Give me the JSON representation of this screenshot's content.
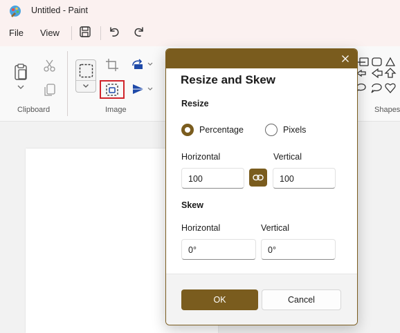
{
  "window": {
    "title": "Untitled - Paint"
  },
  "menu": {
    "file": "File",
    "view": "View"
  },
  "ribbon": {
    "clipboard_label": "Clipboard",
    "image_label": "Image",
    "shapes_label": "Shapes"
  },
  "dialog": {
    "title": "Resize and Skew",
    "resize": {
      "heading": "Resize",
      "option_percentage": "Percentage",
      "option_pixels": "Pixels",
      "selected": "Percentage",
      "horizontal_label": "Horizontal",
      "vertical_label": "Vertical",
      "horizontal_value": "100",
      "vertical_value": "100",
      "maintain_aspect_ratio": true
    },
    "skew": {
      "heading": "Skew",
      "horizontal_label": "Horizontal",
      "vertical_label": "Vertical",
      "horizontal_value": "0°",
      "vertical_value": "0°"
    },
    "ok_label": "OK",
    "cancel_label": "Cancel"
  },
  "colors": {
    "accent": "#7a5c1e",
    "highlight_box": "#d0242b",
    "titlebar_bg": "#fbf1f0"
  },
  "icons": {
    "app": "paint-app-icon",
    "save": "save-icon",
    "undo": "undo-icon",
    "redo": "redo-icon",
    "paste": "paste-icon",
    "cut": "cut-icon",
    "copy": "copy-icon",
    "select": "select-icon",
    "crop": "crop-icon",
    "resize": "resize-icon",
    "rotate": "rotate-icon",
    "flip": "flip-icon",
    "close": "close-icon",
    "link": "link-icon"
  }
}
